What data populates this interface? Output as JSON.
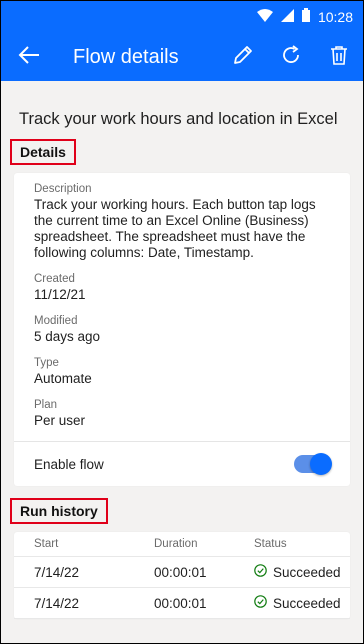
{
  "status_bar": {
    "time": "10:28",
    "icons": [
      "wifi-icon",
      "signal-icon",
      "battery-icon"
    ]
  },
  "app_bar": {
    "title": "Flow details",
    "actions": [
      "back-arrow-icon",
      "edit-pencil-icon",
      "refresh-icon",
      "delete-trash-icon"
    ]
  },
  "flow": {
    "name": "Track your work hours and location in Excel"
  },
  "details": {
    "header": "Details",
    "description_label": "Description",
    "description": "Track your working hours. Each button tap logs the current time to an Excel Online (Business) spreadsheet. The spreadsheet must have the following columns: Date, Timestamp.",
    "created_label": "Created",
    "created": "11/12/21",
    "modified_label": "Modified",
    "modified": "5 days ago",
    "type_label": "Type",
    "type": "Automate",
    "plan_label": "Plan",
    "plan": "Per user",
    "enable_label": "Enable flow",
    "enabled": true
  },
  "run_history": {
    "header": "Run history",
    "columns": [
      "Start",
      "Duration",
      "Status"
    ],
    "rows": [
      {
        "start": "7/14/22",
        "duration": "00:00:01",
        "status": "Succeeded"
      },
      {
        "start": "7/14/22",
        "duration": "00:00:01",
        "status": "Succeeded"
      }
    ]
  },
  "colors": {
    "accent": "#0a6cff",
    "highlight_box": "#e0001a",
    "success": "#107c10"
  }
}
